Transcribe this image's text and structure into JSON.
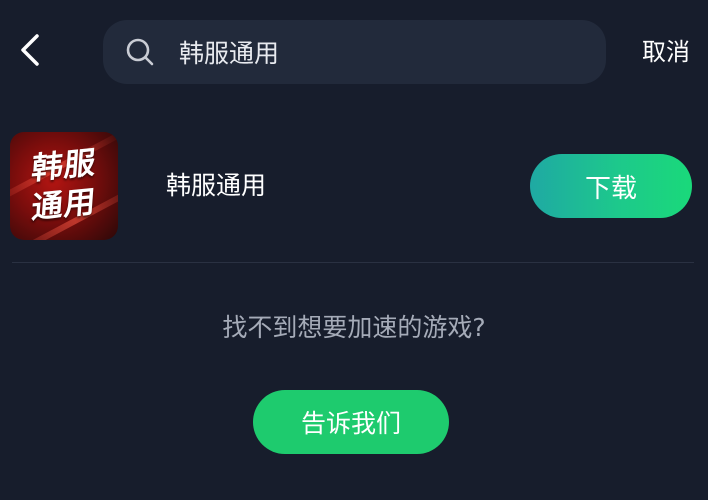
{
  "header": {
    "back_icon": "chevron-left-icon",
    "search": {
      "icon": "search-icon",
      "value": "韩服通用"
    },
    "cancel_label": "取消"
  },
  "result": {
    "app_icon_text": [
      "韩服",
      "通用"
    ],
    "app_name": "韩服通用",
    "download_label": "下载"
  },
  "not_found": {
    "prompt": "找不到想要加速的游戏?",
    "button_label": "告诉我们"
  },
  "colors": {
    "background": "#171d2c",
    "search_bg": "#222a3b",
    "accent_green": "#1ecb6e",
    "accent_teal": "#1fa9a3",
    "muted_text": "#a5abb8"
  }
}
